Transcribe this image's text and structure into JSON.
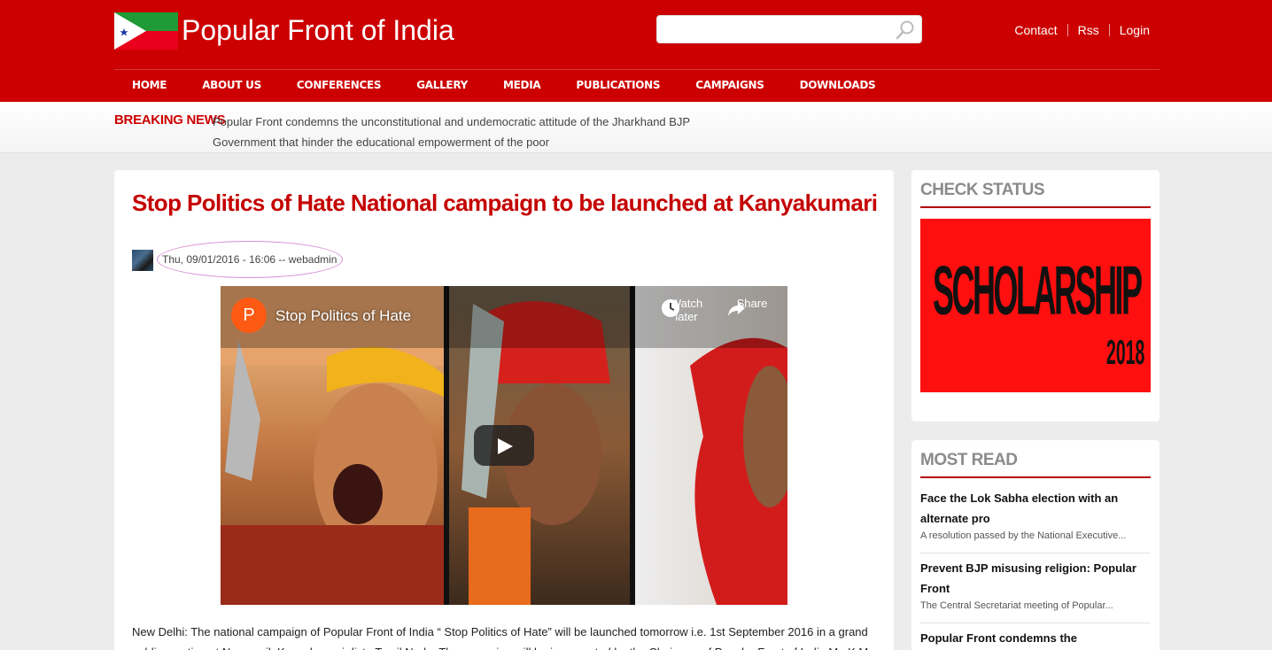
{
  "header": {
    "site_title": "Popular Front of India",
    "search_placeholder": "",
    "links": [
      "Contact",
      "Rss",
      "Login"
    ]
  },
  "nav": [
    "HOME",
    "ABOUT US",
    "CONFERENCES",
    "GALLERY",
    "MEDIA",
    "PUBLICATIONS",
    "CAMPAIGNS",
    "DOWNLOADS"
  ],
  "breaking": {
    "label": "BREAKING NEWS",
    "text": "Popular Front condemns the unconstitutional and undemocratic attitude of the Jharkhand BJP Government that hinder the educational empowerment of the poor"
  },
  "article": {
    "title": "Stop Politics of Hate National campaign to be launched at Kanyakumari",
    "meta": "Thu, 09/01/2016 - 16:06 -- webadmin",
    "video": {
      "channel_initial": "P",
      "title": "Stop Politics of Hate",
      "watch_later": "Watch later",
      "share": "Share"
    },
    "body": "New Delhi: The national campaign of Popular Front of India “ Stop Politics of Hate” will be launched tomorrow i.e. 1st September 2016 in a grand public meeting at Nagercoil, Kanyakumari dist., Tamil Nadu. The campaign will be inaugurated by the Chairman of Popular Front of India Mr. K.M."
  },
  "sidebar": {
    "check_status": {
      "heading": "CHECK STATUS",
      "banner_word": "SCHOLARSHIP",
      "banner_year": "2018"
    },
    "most_read": {
      "heading": "MOST READ",
      "items": [
        {
          "title": "Face the Lok Sabha election with an alternate pro",
          "excerpt": "A resolution passed by the National Executive..."
        },
        {
          "title": "Prevent BJP misusing religion: Popular Front",
          "excerpt": "The Central Secretariat meeting of Popular..."
        },
        {
          "title": "Popular Front condemns the",
          "excerpt": ""
        }
      ]
    }
  },
  "colors": {
    "brand_red": "#cc0000",
    "title_red": "#c40000",
    "flag_green": "#1f9a36",
    "flag_red": "#e8001c",
    "banner_red": "#ff0f0f"
  }
}
